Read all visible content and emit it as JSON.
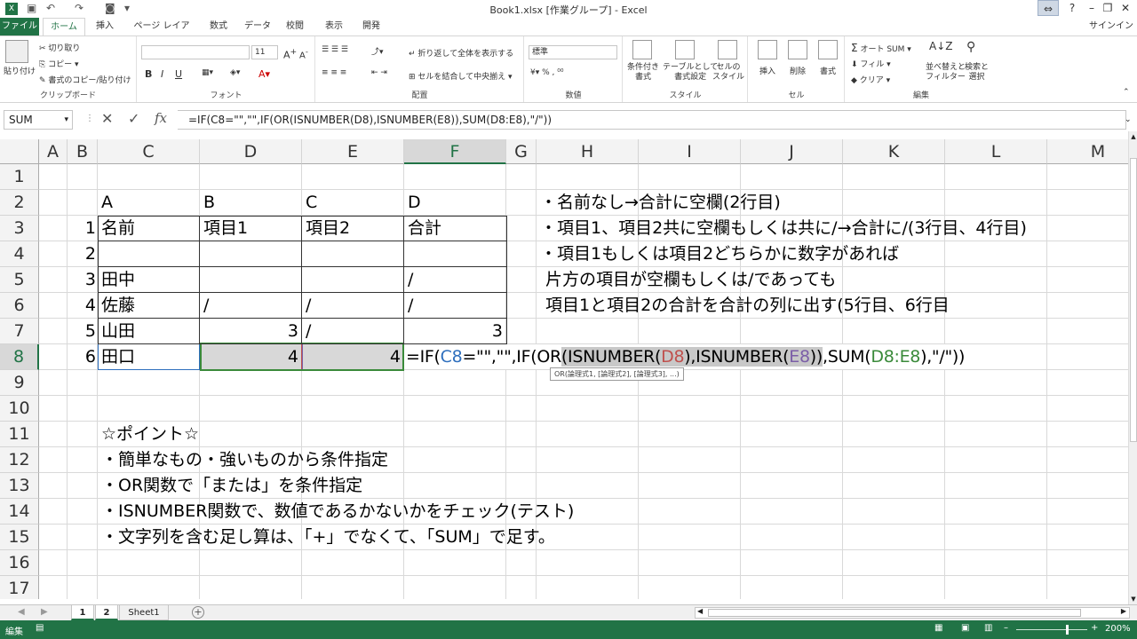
{
  "window": {
    "title": "Book1.xlsx  [作業グループ] - Excel",
    "signin": "サインイン"
  },
  "tabs": [
    "ファイル",
    "ホーム",
    "挿入",
    "ページ レイアウト",
    "数式",
    "データ",
    "校閲",
    "表示",
    "開発"
  ],
  "ribbon": {
    "clipboard": {
      "label": "クリップボード",
      "paste": "貼り付け",
      "cut": "切り取り",
      "copy": "コピー",
      "format_painter": "書式のコピー/貼り付け"
    },
    "font": {
      "label": "フォント",
      "size": "11",
      "bold": "B",
      "italic": "I",
      "underline": "U"
    },
    "alignment": {
      "label": "配置",
      "wrap": "折り返して全体を表示する",
      "merge": "セルを結合して中央揃え"
    },
    "number": {
      "label": "数値",
      "format": "標準"
    },
    "styles": {
      "label": "スタイル",
      "conditional": "条件付き\n書式",
      "table": "テーブルとして\n書式設定",
      "cell": "セルの\nスタイル"
    },
    "cells": {
      "label": "セル",
      "insert": "挿入",
      "delete": "削除",
      "format": "書式"
    },
    "editing": {
      "label": "編集",
      "autosum": "オート SUM",
      "fill": "フィル",
      "clear": "クリア",
      "sort": "並べ替えと\nフィルター",
      "find": "検索と\n選択"
    }
  },
  "formula_bar": {
    "namebox": "SUM",
    "fx": "fx",
    "formula": "=IF(C8=\"\",\"\",IF(OR(ISNUMBER(D8),ISNUMBER(E8)),SUM(D8:E8),\"/\"))"
  },
  "columns": [
    "A",
    "B",
    "C",
    "D",
    "E",
    "F",
    "G",
    "H",
    "I",
    "J",
    "K",
    "L",
    "M"
  ],
  "rows": [
    "1",
    "2",
    "3",
    "4",
    "5",
    "6",
    "7",
    "8",
    "9",
    "10",
    "11",
    "12",
    "13",
    "14",
    "15",
    "16",
    "17"
  ],
  "table": {
    "letters": [
      "A",
      "B",
      "C",
      "D"
    ],
    "header": [
      "名前",
      "項目1",
      "項目2",
      "合計"
    ],
    "nums": [
      "1",
      "2",
      "3",
      "4",
      "5",
      "6"
    ],
    "r5": [
      "田中",
      "",
      "",
      "/"
    ],
    "r6": [
      "佐藤",
      "/",
      "/",
      "/"
    ],
    "r7": [
      "山田",
      "3",
      "/",
      "3"
    ],
    "r8": [
      "田口",
      "4",
      "4"
    ]
  },
  "notes": [
    "・名前なし→合計に空欄(2行目)",
    "・項目1、項目2共に空欄もしくは共に/→合計に/(3行目、4行目)",
    "・項目1もしくは項目2どちらかに数字があれば",
    " 片方の項目が空欄もしくは/であっても",
    " 項目1と項目2の合計を合計の列に出す(5行目、6行目"
  ],
  "points": [
    "☆ポイント☆",
    "・簡単なもの・強いものから条件指定",
    "・OR関数で「または」を条件指定",
    "・ISNUMBER関数で、数値であるかないかをチェック(テスト)",
    "・文字列を含む足し算は、「+」でなくて、「SUM」で足す。"
  ],
  "edit": {
    "p1": "=IF(",
    "c8": "C8",
    "p2": "=\"\",\"\",IF(",
    "or": "OR",
    "paren": "(",
    "isn1": "ISNUMBER(",
    "d8": "D8",
    "close1": "),",
    "isn2": "ISNUMBER(",
    "e8": "E8",
    "close2": "))",
    "p3": ",SUM(",
    "d8e8": "D8:E8",
    "p4": "),\"/\"))"
  },
  "tooltip": "OR(論理式1, [論理式2], [論理式3], ...)",
  "sheets": [
    "1",
    "2",
    "Sheet1"
  ],
  "status": {
    "mode": "編集",
    "zoom": "200%"
  },
  "colors": {
    "accent": "#217346",
    "ref_blue": "#2e6fbd",
    "ref_red": "#c0504d",
    "ref_purple": "#7b5ea7",
    "ref_green": "#3a8a3a"
  }
}
